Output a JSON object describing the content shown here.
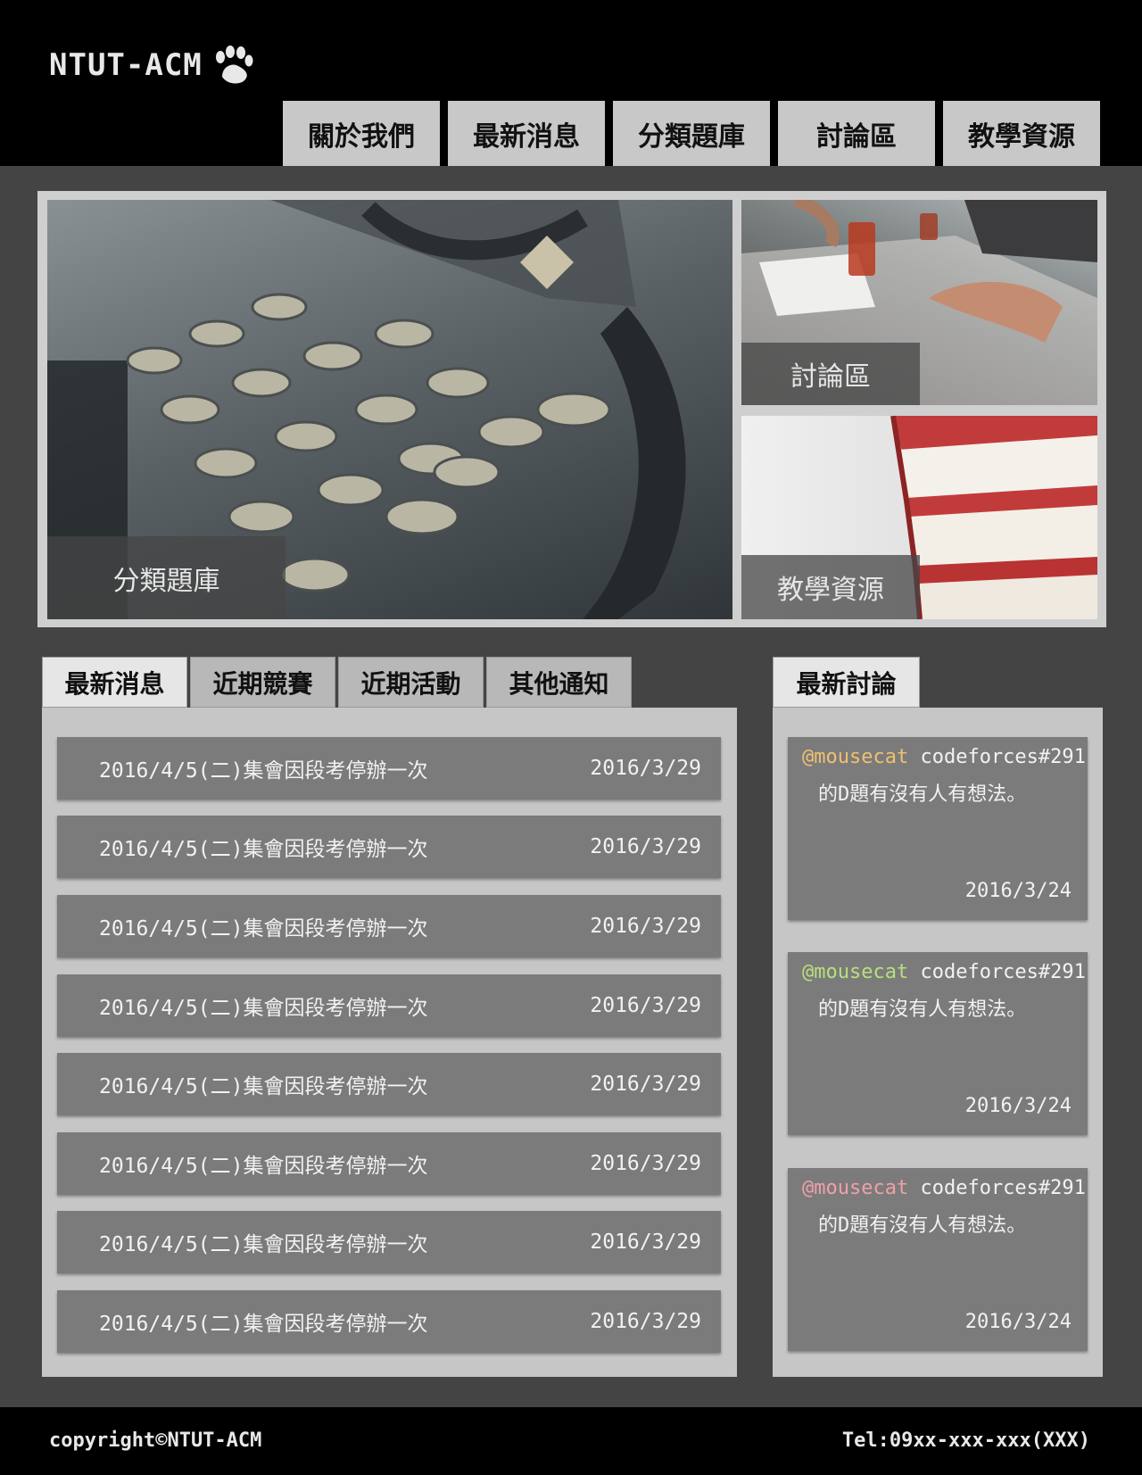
{
  "header": {
    "logo_text": "NTUT-ACM",
    "logo_icon": "paw-icon",
    "nav": [
      {
        "label": "關於我們"
      },
      {
        "label": "最新消息"
      },
      {
        "label": "分類題庫"
      },
      {
        "label": "討論區"
      },
      {
        "label": "教學資源"
      }
    ]
  },
  "hero": {
    "main": {
      "label": "分類題庫"
    },
    "discuss": {
      "label": "討論區"
    },
    "books": {
      "label": "教學資源"
    }
  },
  "news": {
    "tabs": [
      {
        "label": "最新消息"
      },
      {
        "label": "近期競賽"
      },
      {
        "label": "近期活動"
      },
      {
        "label": "其他通知"
      }
    ],
    "items": [
      {
        "title": "2016/4/5(二)集會因段考停辦一次",
        "date": "2016/3/29"
      },
      {
        "title": "2016/4/5(二)集會因段考停辦一次",
        "date": "2016/3/29"
      },
      {
        "title": "2016/4/5(二)集會因段考停辦一次",
        "date": "2016/3/29"
      },
      {
        "title": "2016/4/5(二)集會因段考停辦一次",
        "date": "2016/3/29"
      },
      {
        "title": "2016/4/5(二)集會因段考停辦一次",
        "date": "2016/3/29"
      },
      {
        "title": "2016/4/5(二)集會因段考停辦一次",
        "date": "2016/3/29"
      },
      {
        "title": "2016/4/5(二)集會因段考停辦一次",
        "date": "2016/3/29"
      },
      {
        "title": "2016/4/5(二)集會因段考停辦一次",
        "date": "2016/3/29"
      }
    ]
  },
  "discussion": {
    "tab_label": "最新討論",
    "items": [
      {
        "user": "@mousecat",
        "user_color": "#f0c070",
        "text1": "codeforces#291",
        "text2": "的D題有沒有人有想法。",
        "date": "2016/3/24"
      },
      {
        "user": "@mousecat",
        "user_color": "#b8e07a",
        "text1": "codeforces#291",
        "text2": "的D題有沒有人有想法。",
        "date": "2016/3/24"
      },
      {
        "user": "@mousecat",
        "user_color": "#f0a0a8",
        "text1": "codeforces#291",
        "text2": "的D題有沒有人有想法。",
        "date": "2016/3/24"
      }
    ]
  },
  "footer": {
    "copyright": "copyright©NTUT-ACM",
    "tel": "Tel:09xx-xxx-xxx(XXX)"
  }
}
